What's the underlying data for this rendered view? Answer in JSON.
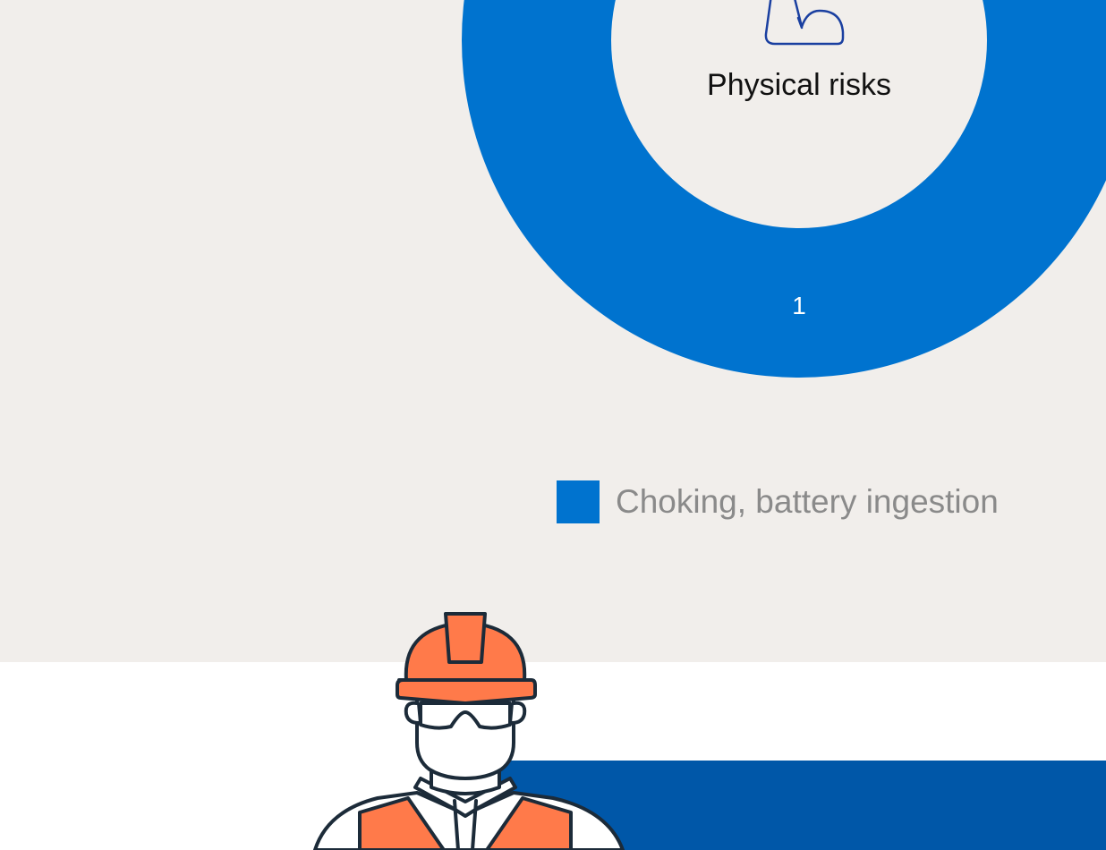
{
  "colors": {
    "background_top": "#f1eeeb",
    "background_bottom": "#ffffff",
    "slice": "#0073cf",
    "panel": "#0057a8",
    "vest": "#ff7a4a",
    "outline": "#1c2b39",
    "legend_text": "#8a8a8a"
  },
  "chart_data": {
    "type": "pie",
    "style": "donut",
    "center_label": "Physical risks",
    "center_icon": "physical-risk-icon",
    "slices": [
      {
        "label": "Choking, battery ingestion",
        "value": 1,
        "color": "#0073cf"
      }
    ],
    "legend_placement": "bottom-right"
  },
  "illustration": {
    "icon": "construction-worker-icon"
  }
}
